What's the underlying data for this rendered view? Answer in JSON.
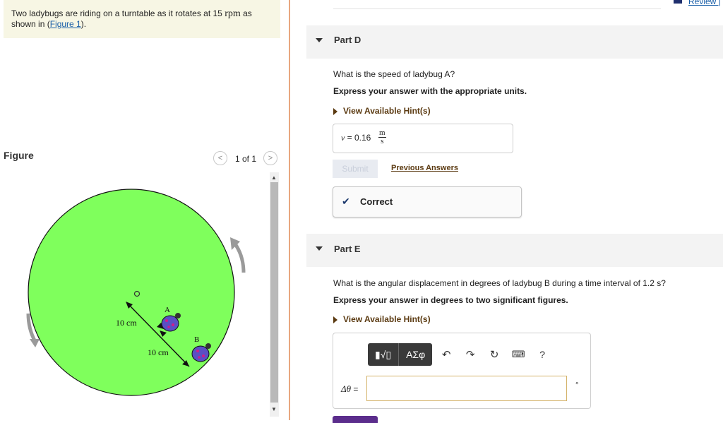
{
  "header": {
    "review_link": "Review |"
  },
  "problem": {
    "text_part1": "Two ladybugs are riding on a turntable as it rotates at 15 ",
    "rpm": "rpm",
    "text_part2": " as",
    "text_line2a": "shown in (",
    "figure_link": "Figure 1",
    "text_line2b": ")."
  },
  "figure": {
    "label": "Figure",
    "prev_icon": "chevron-left-icon",
    "next_icon": "chevron-right-icon",
    "page_count": "1 of 1",
    "labels": {
      "a": "A",
      "b": "B",
      "dist1": "10 cm",
      "dist2": "10 cm"
    },
    "colors": {
      "disk": "#7fff5c",
      "ladybug": "#5a4fc4"
    }
  },
  "partD": {
    "title": "Part D",
    "question": "What is the speed of ladybug A?",
    "instruction": "Express your answer with the appropriate units.",
    "hint": "View Available Hint(s)",
    "answer_var": "v",
    "answer_eq": " =  0.16",
    "unit_num": "m",
    "unit_den": "s",
    "submit": "Submit",
    "previous_answers": "Previous Answers",
    "correct": "Correct"
  },
  "partE": {
    "title": "Part E",
    "question": "What is the angular displacement in degrees of ladybug B during a time interval of 1.2 s?",
    "instruction": "Express your answer in degrees to two significant figures.",
    "hint": "View Available Hint(s)",
    "toolbar": {
      "templates": "▮√▯",
      "symbols": "ΑΣφ",
      "help": "?"
    },
    "input_label_sym": "Δθ",
    "input_label_eq": " =",
    "unit": "°"
  }
}
